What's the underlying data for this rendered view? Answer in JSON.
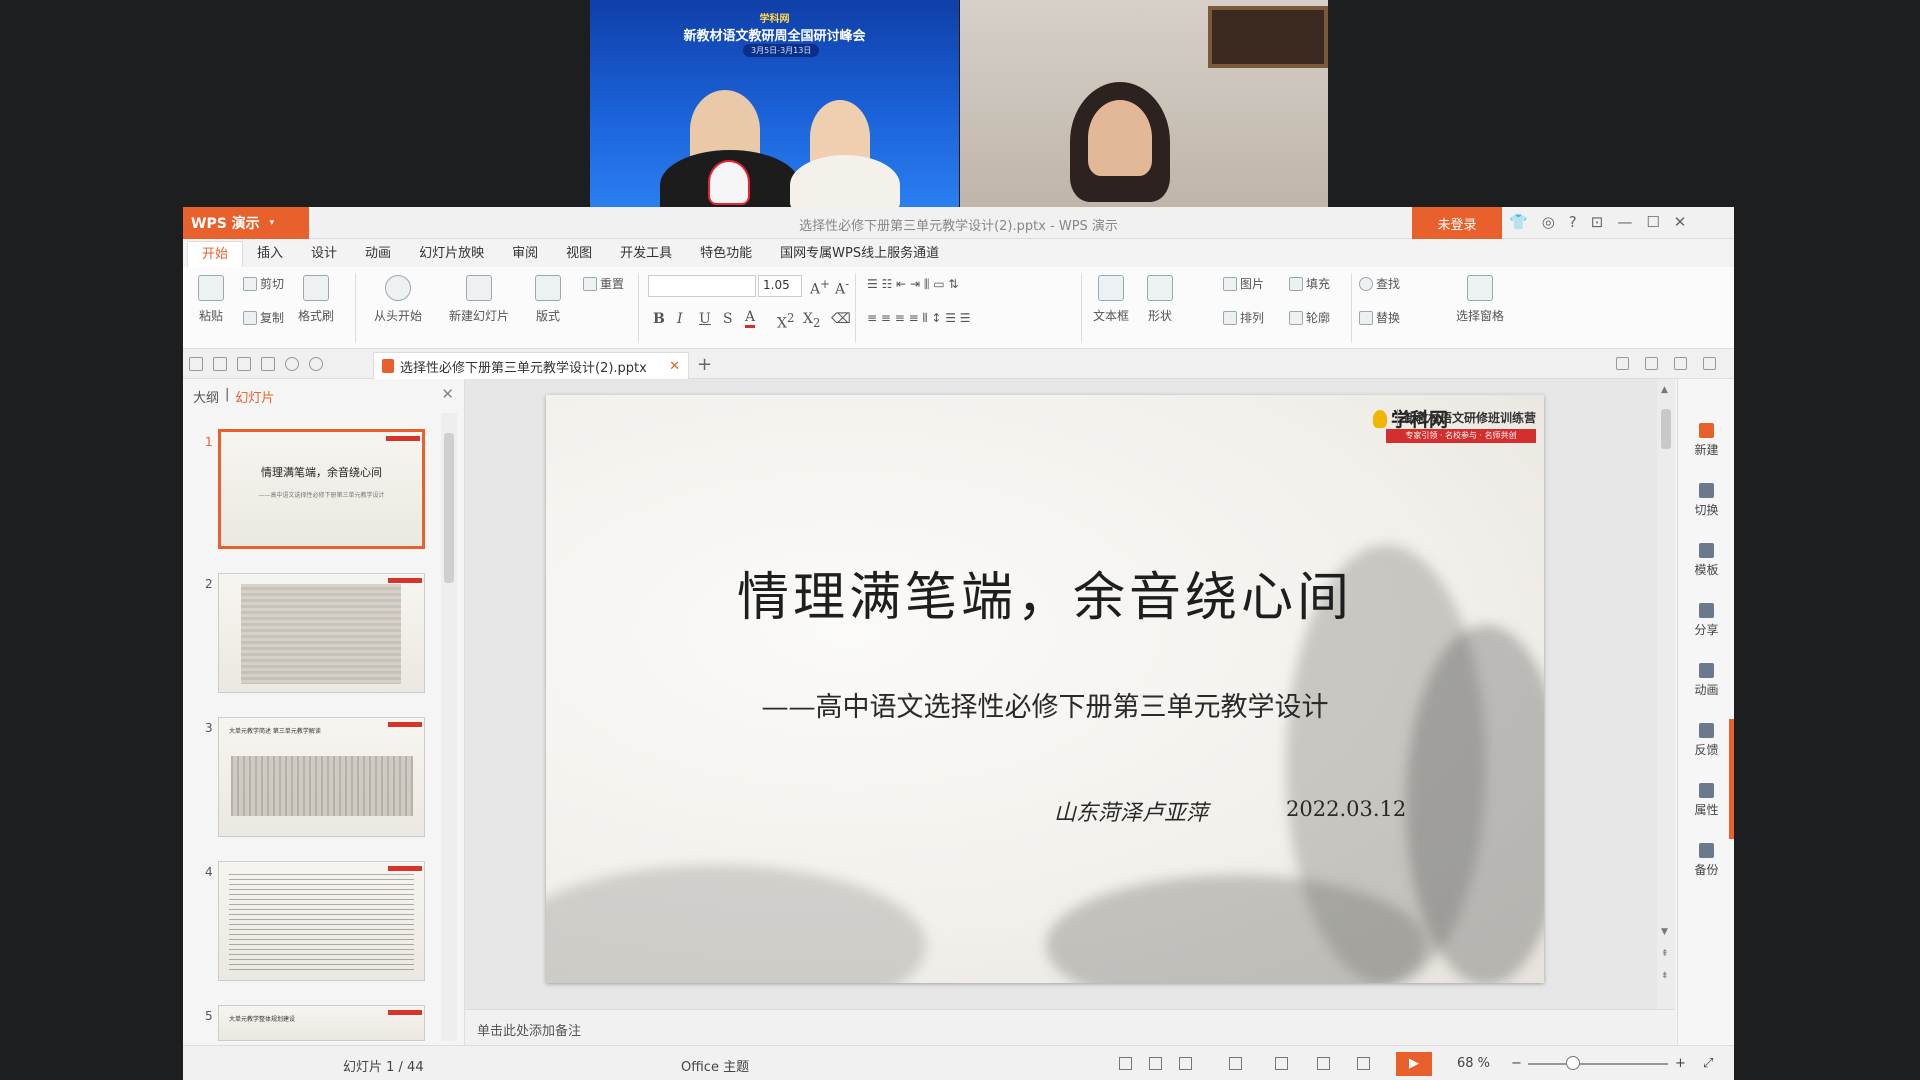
{
  "video": {
    "conference_logo": "学科网",
    "conference_title": "新教材语文教研周全国研讨峰会",
    "conference_date": "3月5日-3月13日"
  },
  "window": {
    "app_name": "WPS 演示",
    "title": "选择性必修下册第三单元教学设计(2).pptx - WPS 演示",
    "login_label": "未登录"
  },
  "menu": [
    "开始",
    "插入",
    "设计",
    "动画",
    "幻灯片放映",
    "审阅",
    "视图",
    "开发工具",
    "特色功能",
    "国网专属WPS线上服务通道"
  ],
  "ribbon": {
    "paste": "粘贴",
    "cut": "剪切",
    "copy": "复制",
    "format_painter": "格式刷",
    "from_start": "从头开始",
    "new_slide": "新建幻灯片",
    "layout": "版式",
    "reset": "重置",
    "font_size": "1.05",
    "textbox": "文本框",
    "shape": "形状",
    "picture": "图片",
    "fill": "填充",
    "arrange": "排列",
    "outline": "轮廓",
    "find": "查找",
    "replace": "替换",
    "select_pane": "选择窗格"
  },
  "doc_tab": "选择性必修下册第三单元教学设计(2).pptx",
  "left_panel": {
    "tab_outline": "大纲",
    "tab_slides": "幻灯片",
    "thumbs": [
      {
        "num": "1",
        "title": "情理满笔端，余音绕心间",
        "sub": "——高中语文选择性必修下册第三单元教学设计"
      },
      {
        "num": "2"
      },
      {
        "num": "3",
        "title": "大单元教学简述 第三单元教学解读"
      },
      {
        "num": "4"
      },
      {
        "num": "5",
        "title": "大单元教学整体规划建设"
      }
    ]
  },
  "slide": {
    "logo": "学科网",
    "camp": "新教材语文研修班训练营",
    "tag": "专家引领 · 名校参与 · 名师共创",
    "title": "情理满笔端，余音绕心间",
    "subtitle": "——高中语文选择性必修下册第三单元教学设计",
    "author": "山东菏泽卢亚萍",
    "date": "2022.03.12"
  },
  "notes_placeholder": "单击此处添加备注",
  "right_bar": [
    "新建",
    "切换",
    "模板",
    "分享",
    "动画",
    "反馈",
    "属性",
    "备份"
  ],
  "status": {
    "slide_count": "幻灯片 1 / 44",
    "theme": "Office 主题",
    "zoom": "68 %"
  }
}
